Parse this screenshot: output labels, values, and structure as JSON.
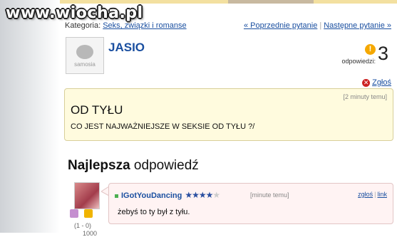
{
  "watermark": "www.wiocha.pl",
  "category": {
    "label": "Kategoria:",
    "link": "Seks, związki i romanse"
  },
  "nav": {
    "prev": "« Poprzednie pytanie",
    "next": "Następne pytanie »"
  },
  "avatar_logo": "samosia",
  "user": {
    "name": "JASIO"
  },
  "answers": {
    "count": "3",
    "label": "odpowiedzi:",
    "badge": "!"
  },
  "report_label": "Zgłoś",
  "question": {
    "time": "[2 minuty temu]",
    "title": "OD TYŁU",
    "body": "CO JEST NAJWAŻNIEJSZE W SEKSIE OD TYŁU ?/"
  },
  "best_answer": {
    "bold": "Najlepsza",
    "rest": " odpowiedź"
  },
  "answer": {
    "user": "IGotYouDancing",
    "rating_filled": 3.5,
    "rating_max": 5,
    "time": "[minute temu]",
    "report": "zgłoś",
    "link": "link",
    "text": "żebyś to ty był z tyłu.",
    "votes": "(1 - 0)",
    "extra": "1000"
  },
  "colors": {
    "link": "#1a4fa0",
    "question_bg": "#fffbde",
    "answer_bg": "#fff3f3"
  }
}
